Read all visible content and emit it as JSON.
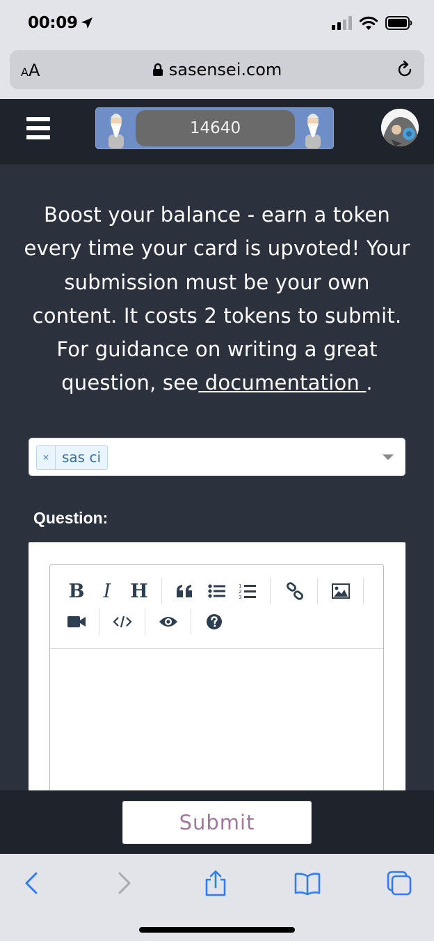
{
  "status_bar": {
    "time": "00:09"
  },
  "browser": {
    "text_size_label_small": "A",
    "text_size_label_large": "A",
    "domain": "sasensei.com"
  },
  "header": {
    "balance": "14640"
  },
  "intro": {
    "text": "Boost your balance - earn a token every time your card is upvoted! Your submission must be your own content. It costs 2 tokens to submit. For guidance on writing a great question, see",
    "link_text": " documentation ",
    "trailing": "."
  },
  "tag_select": {
    "remove_label": "×",
    "selected_tag": "sas ci"
  },
  "form": {
    "question_label": "Question:"
  },
  "editor": {
    "toolbar": {
      "bold": "B",
      "italic": "I",
      "heading": "H"
    }
  },
  "submit": {
    "label": "Submit"
  },
  "colors": {
    "page_bg": "#2b313d",
    "header_bg": "#1e232c",
    "balance_box": "#6f8ec7",
    "submit_text": "#a3779a",
    "ios_accent": "#2f7cf6"
  }
}
